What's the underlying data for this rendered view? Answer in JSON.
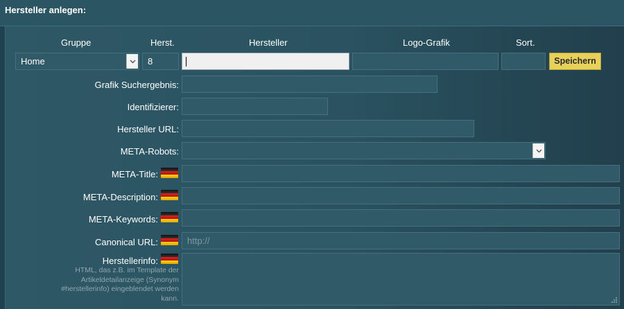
{
  "panel": {
    "title": "Hersteller anlegen:"
  },
  "columns": {
    "gruppe": "Gruppe",
    "herst": "Herst.",
    "hersteller": "Hersteller",
    "logo": "Logo-Grafik",
    "sort": "Sort."
  },
  "row_main": {
    "gruppe_value": "Home",
    "herst_value": "8",
    "hersteller_value": "",
    "logo_value": "",
    "sort_value": "",
    "save_label": "Speichern"
  },
  "fields": {
    "grafik_suchergebnis": {
      "label": "Grafik Suchergebnis:",
      "value": ""
    },
    "identifizierer": {
      "label": "Identifizierer:",
      "value": ""
    },
    "hersteller_url": {
      "label": "Hersteller URL:",
      "value": ""
    },
    "meta_robots": {
      "label": "META-Robots:",
      "value": ""
    },
    "meta_title": {
      "label": "META-Title:",
      "value": ""
    },
    "meta_description": {
      "label": "META-Description:",
      "value": ""
    },
    "meta_keywords": {
      "label": "META-Keywords:",
      "value": ""
    },
    "canonical_url": {
      "label": "Canonical URL:",
      "placeholder": "http://"
    },
    "herstellerinfo": {
      "label": "Herstellerinfo:",
      "hint": "HTML, das z.B. im Template der Artikeldetailanzeige (Synonym #herstellerinfo) eingeblendet werden kann."
    }
  },
  "icons": {
    "flag": "german-flag-icon",
    "dropdown": "chevron-down-icon",
    "resize": "resize-grip-icon"
  },
  "colors": {
    "background": "#1f4250",
    "field": "#315a68",
    "save_button": "#e8d15a"
  }
}
